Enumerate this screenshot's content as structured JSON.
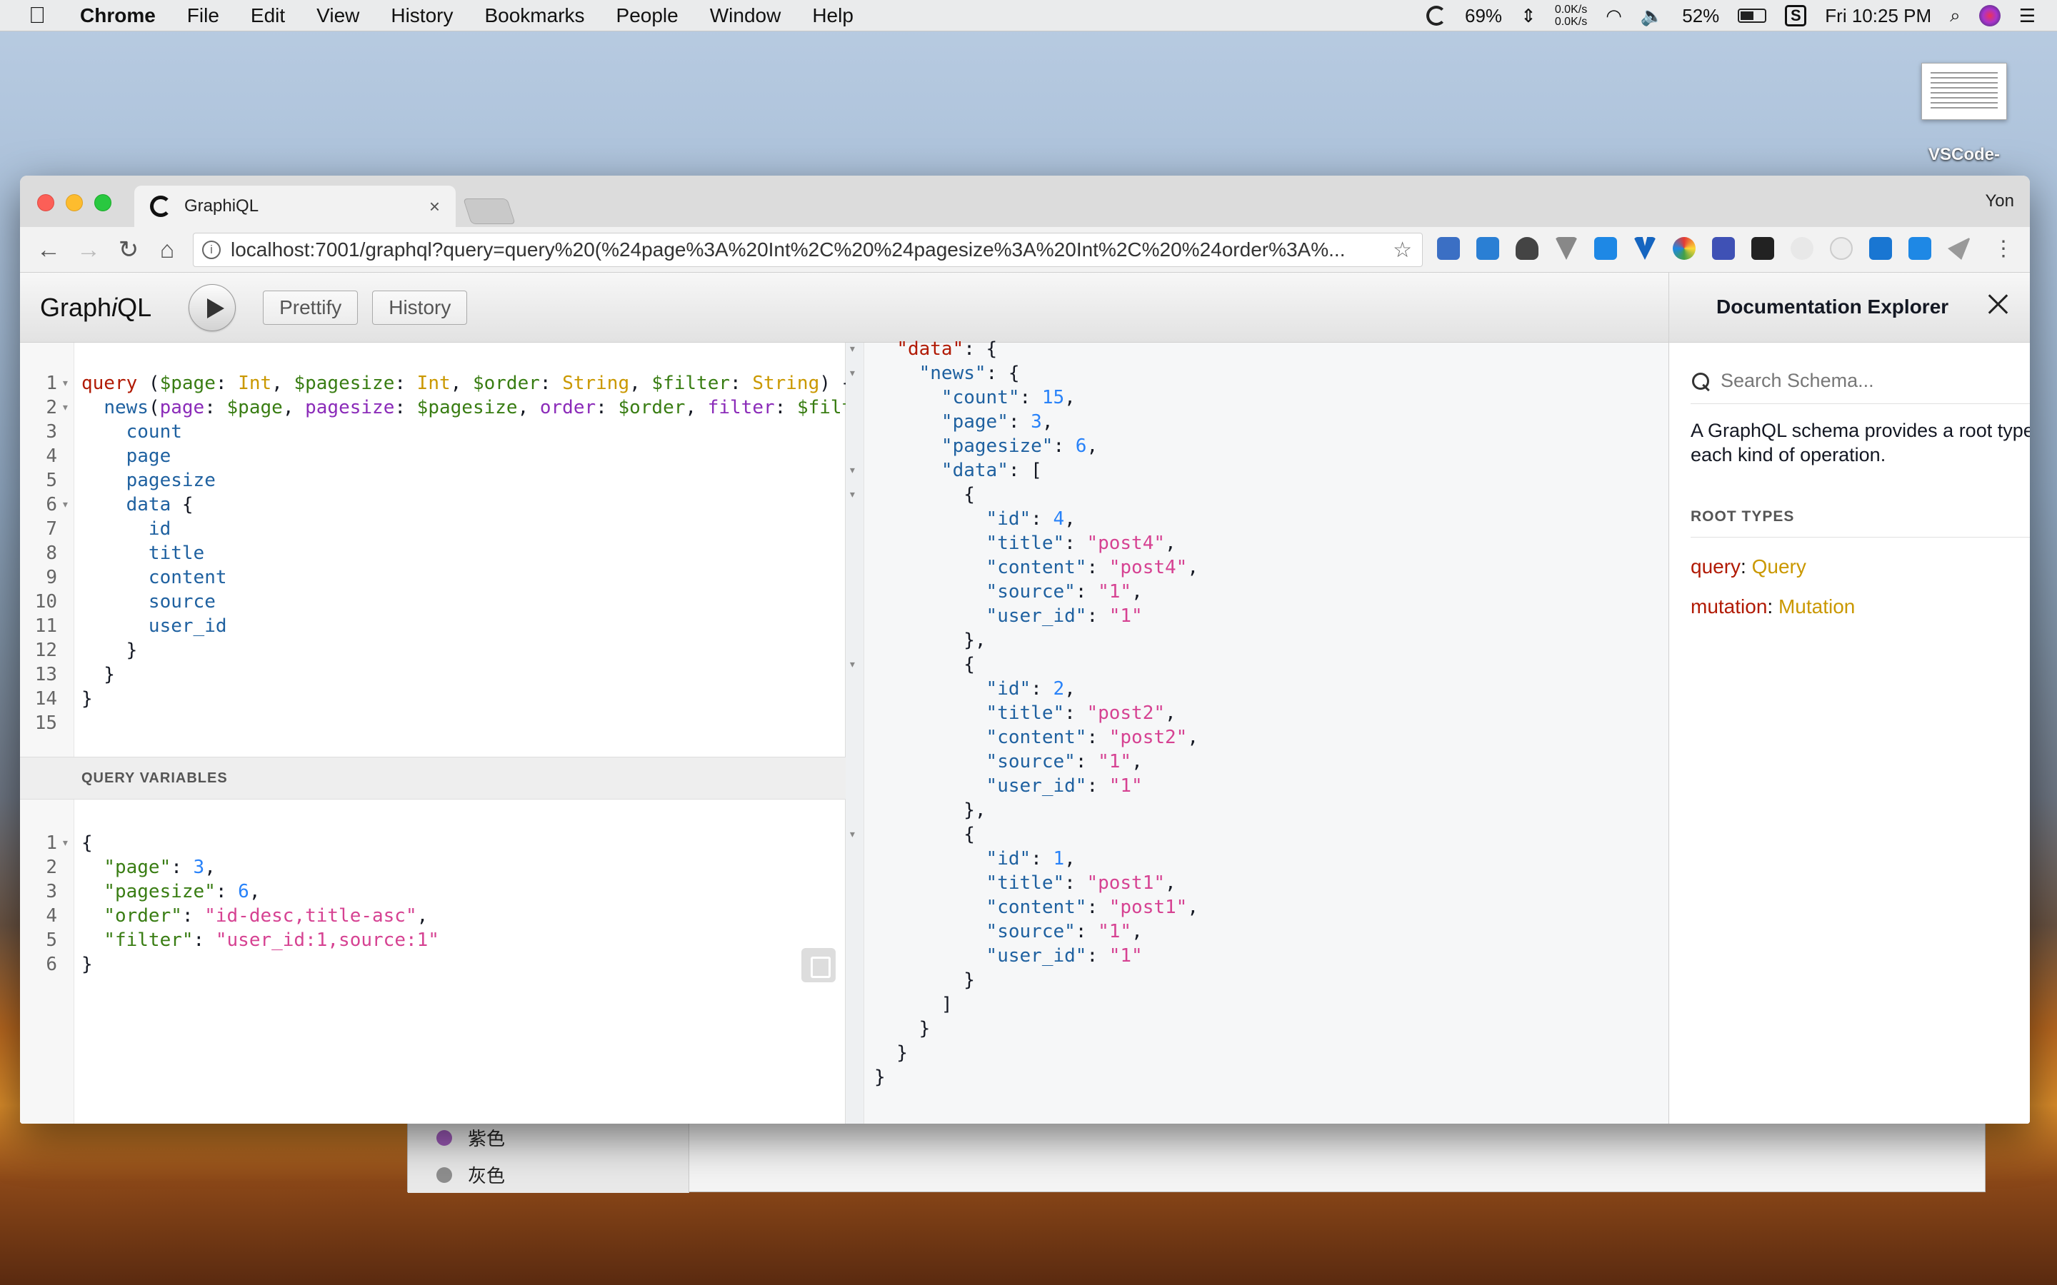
{
  "menubar": {
    "app": "Chrome",
    "items": [
      "File",
      "Edit",
      "View",
      "History",
      "Bookmarks",
      "People",
      "Window",
      "Help"
    ],
    "cpu": "69%",
    "net_up": "0.0K/s",
    "net_down": "0.0K/s",
    "battery": "52%",
    "clock": "Fri 10:25 PM"
  },
  "desktop": {
    "icon_label": "VSCode-",
    "back_window": {
      "items": [
        {
          "label": "紫色",
          "color": "#9b59b6"
        },
        {
          "label": "灰色",
          "color": "#8e8e8e"
        }
      ]
    }
  },
  "browser": {
    "tab_title": "GraphiQL",
    "tab_close": "×",
    "user": "Yon",
    "url": "localhost:7001/graphql?query=query%20(%24page%3A%20Int%2C%20%24pagesize%3A%20Int%2C%20%24order%3A%..."
  },
  "graphiql": {
    "logo_pre": "Graph",
    "logo_i": "i",
    "logo_post": "QL",
    "prettify": "Prettify",
    "history": "History",
    "query_variables_title": "QUERY VARIABLES"
  },
  "query_lines": [
    [
      [
        "kw",
        "query"
      ],
      [
        "p",
        " ("
      ],
      [
        "var",
        "$page"
      ],
      [
        "p",
        ": "
      ],
      [
        "type",
        "Int"
      ],
      [
        "p",
        ", "
      ],
      [
        "var",
        "$pagesize"
      ],
      [
        "p",
        ": "
      ],
      [
        "type",
        "Int"
      ],
      [
        "p",
        ", "
      ],
      [
        "var",
        "$order"
      ],
      [
        "p",
        ": "
      ],
      [
        "type",
        "String"
      ],
      [
        "p",
        ", "
      ],
      [
        "var",
        "$filter"
      ],
      [
        "p",
        ": "
      ],
      [
        "type",
        "String"
      ],
      [
        "p",
        ") {"
      ]
    ],
    [
      [
        "p",
        "  "
      ],
      [
        "def",
        "news"
      ],
      [
        "p",
        "("
      ],
      [
        "attr",
        "page"
      ],
      [
        "p",
        ": "
      ],
      [
        "var",
        "$page"
      ],
      [
        "p",
        ", "
      ],
      [
        "attr",
        "pagesize"
      ],
      [
        "p",
        ": "
      ],
      [
        "var",
        "$pagesize"
      ],
      [
        "p",
        ", "
      ],
      [
        "attr",
        "order"
      ],
      [
        "p",
        ": "
      ],
      [
        "var",
        "$order"
      ],
      [
        "p",
        ", "
      ],
      [
        "attr",
        "filter"
      ],
      [
        "p",
        ": "
      ],
      [
        "var",
        "$filter"
      ],
      [
        "p",
        ") {"
      ]
    ],
    [
      [
        "p",
        "    "
      ],
      [
        "prop",
        "count"
      ]
    ],
    [
      [
        "p",
        "    "
      ],
      [
        "prop",
        "page"
      ]
    ],
    [
      [
        "p",
        "    "
      ],
      [
        "prop",
        "pagesize"
      ]
    ],
    [
      [
        "p",
        "    "
      ],
      [
        "prop",
        "data"
      ],
      [
        "p",
        " {"
      ]
    ],
    [
      [
        "p",
        "      "
      ],
      [
        "prop",
        "id"
      ]
    ],
    [
      [
        "p",
        "      "
      ],
      [
        "prop",
        "title"
      ]
    ],
    [
      [
        "p",
        "      "
      ],
      [
        "prop",
        "content"
      ]
    ],
    [
      [
        "p",
        "      "
      ],
      [
        "prop",
        "source"
      ]
    ],
    [
      [
        "p",
        "      "
      ],
      [
        "prop",
        "user_id"
      ]
    ],
    [
      [
        "p",
        "    }"
      ]
    ],
    [
      [
        "p",
        "  }"
      ]
    ],
    [
      [
        "p",
        "}"
      ]
    ],
    [
      [
        "p",
        ""
      ]
    ]
  ],
  "query_folds": [
    1,
    2,
    6
  ],
  "variables_lines": [
    [
      [
        "p",
        "{"
      ]
    ],
    [
      [
        "p",
        "  "
      ],
      [
        "var",
        "\"page\""
      ],
      [
        "p",
        ": "
      ],
      [
        "num",
        "3"
      ],
      [
        "p",
        ","
      ]
    ],
    [
      [
        "p",
        "  "
      ],
      [
        "var",
        "\"pagesize\""
      ],
      [
        "p",
        ": "
      ],
      [
        "num",
        "6"
      ],
      [
        "p",
        ","
      ]
    ],
    [
      [
        "p",
        "  "
      ],
      [
        "var",
        "\"order\""
      ],
      [
        "p",
        ": "
      ],
      [
        "str",
        "\"id-desc,title-asc\""
      ],
      [
        "p",
        ","
      ]
    ],
    [
      [
        "p",
        "  "
      ],
      [
        "var",
        "\"filter\""
      ],
      [
        "p",
        ": "
      ],
      [
        "str",
        "\"user_id:1,source:1\""
      ]
    ],
    [
      [
        "p",
        "}"
      ]
    ]
  ],
  "variables_folds": [
    1
  ],
  "result_lines": [
    [
      [
        "p",
        "  "
      ],
      [
        "kw",
        "\"data\""
      ],
      [
        "p",
        ": {"
      ]
    ],
    [
      [
        "p",
        "    "
      ],
      [
        "def",
        "\"news\""
      ],
      [
        "p",
        ": {"
      ]
    ],
    [
      [
        "p",
        "      "
      ],
      [
        "def",
        "\"count\""
      ],
      [
        "p",
        ": "
      ],
      [
        "num",
        "15"
      ],
      [
        "p",
        ","
      ]
    ],
    [
      [
        "p",
        "      "
      ],
      [
        "def",
        "\"page\""
      ],
      [
        "p",
        ": "
      ],
      [
        "num",
        "3"
      ],
      [
        "p",
        ","
      ]
    ],
    [
      [
        "p",
        "      "
      ],
      [
        "def",
        "\"pagesize\""
      ],
      [
        "p",
        ": "
      ],
      [
        "num",
        "6"
      ],
      [
        "p",
        ","
      ]
    ],
    [
      [
        "p",
        "      "
      ],
      [
        "def",
        "\"data\""
      ],
      [
        "p",
        ": ["
      ]
    ],
    [
      [
        "p",
        "        {"
      ]
    ],
    [
      [
        "p",
        "          "
      ],
      [
        "def",
        "\"id\""
      ],
      [
        "p",
        ": "
      ],
      [
        "num",
        "4"
      ],
      [
        "p",
        ","
      ]
    ],
    [
      [
        "p",
        "          "
      ],
      [
        "def",
        "\"title\""
      ],
      [
        "p",
        ": "
      ],
      [
        "str",
        "\"post4\""
      ],
      [
        "p",
        ","
      ]
    ],
    [
      [
        "p",
        "          "
      ],
      [
        "def",
        "\"content\""
      ],
      [
        "p",
        ": "
      ],
      [
        "str",
        "\"post4\""
      ],
      [
        "p",
        ","
      ]
    ],
    [
      [
        "p",
        "          "
      ],
      [
        "def",
        "\"source\""
      ],
      [
        "p",
        ": "
      ],
      [
        "str",
        "\"1\""
      ],
      [
        "p",
        ","
      ]
    ],
    [
      [
        "p",
        "          "
      ],
      [
        "def",
        "\"user_id\""
      ],
      [
        "p",
        ": "
      ],
      [
        "str",
        "\"1\""
      ]
    ],
    [
      [
        "p",
        "        },"
      ]
    ],
    [
      [
        "p",
        "        {"
      ]
    ],
    [
      [
        "p",
        "          "
      ],
      [
        "def",
        "\"id\""
      ],
      [
        "p",
        ": "
      ],
      [
        "num",
        "2"
      ],
      [
        "p",
        ","
      ]
    ],
    [
      [
        "p",
        "          "
      ],
      [
        "def",
        "\"title\""
      ],
      [
        "p",
        ": "
      ],
      [
        "str",
        "\"post2\""
      ],
      [
        "p",
        ","
      ]
    ],
    [
      [
        "p",
        "          "
      ],
      [
        "def",
        "\"content\""
      ],
      [
        "p",
        ": "
      ],
      [
        "str",
        "\"post2\""
      ],
      [
        "p",
        ","
      ]
    ],
    [
      [
        "p",
        "          "
      ],
      [
        "def",
        "\"source\""
      ],
      [
        "p",
        ": "
      ],
      [
        "str",
        "\"1\""
      ],
      [
        "p",
        ","
      ]
    ],
    [
      [
        "p",
        "          "
      ],
      [
        "def",
        "\"user_id\""
      ],
      [
        "p",
        ": "
      ],
      [
        "str",
        "\"1\""
      ]
    ],
    [
      [
        "p",
        "        },"
      ]
    ],
    [
      [
        "p",
        "        {"
      ]
    ],
    [
      [
        "p",
        "          "
      ],
      [
        "def",
        "\"id\""
      ],
      [
        "p",
        ": "
      ],
      [
        "num",
        "1"
      ],
      [
        "p",
        ","
      ]
    ],
    [
      [
        "p",
        "          "
      ],
      [
        "def",
        "\"title\""
      ],
      [
        "p",
        ": "
      ],
      [
        "str",
        "\"post1\""
      ],
      [
        "p",
        ","
      ]
    ],
    [
      [
        "p",
        "          "
      ],
      [
        "def",
        "\"content\""
      ],
      [
        "p",
        ": "
      ],
      [
        "str",
        "\"post1\""
      ],
      [
        "p",
        ","
      ]
    ],
    [
      [
        "p",
        "          "
      ],
      [
        "def",
        "\"source\""
      ],
      [
        "p",
        ": "
      ],
      [
        "str",
        "\"1\""
      ],
      [
        "p",
        ","
      ]
    ],
    [
      [
        "p",
        "          "
      ],
      [
        "def",
        "\"user_id\""
      ],
      [
        "p",
        ": "
      ],
      [
        "str",
        "\"1\""
      ]
    ],
    [
      [
        "p",
        "        }"
      ]
    ],
    [
      [
        "p",
        "      ]"
      ]
    ],
    [
      [
        "p",
        "    }"
      ]
    ],
    [
      [
        "p",
        "  }"
      ]
    ],
    [
      [
        "p",
        "}"
      ]
    ]
  ],
  "result_folds": [
    1,
    2,
    6,
    7,
    14,
    21
  ],
  "docs": {
    "title": "Documentation Explorer",
    "search_placeholder": "Search Schema...",
    "description": "A GraphQL schema provides a root type for each kind of operation.",
    "root_types_title": "ROOT TYPES",
    "root_types": [
      {
        "field": "query",
        "type": "Query"
      },
      {
        "field": "mutation",
        "type": "Mutation"
      }
    ]
  }
}
